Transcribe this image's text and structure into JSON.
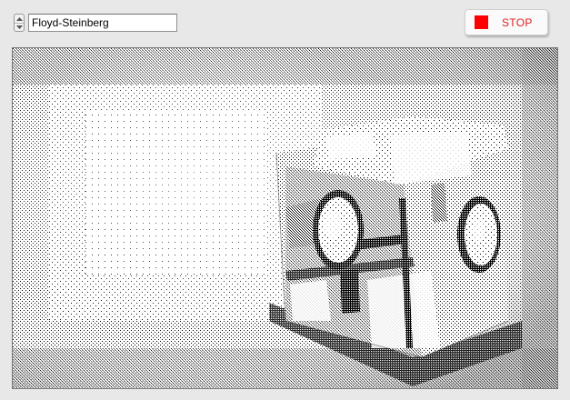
{
  "controls": {
    "dither_algorithm": "Floyd-Steinberg",
    "stop_label": "STOP"
  },
  "colors": {
    "stop_icon": "#ff0000",
    "stop_text": "#e41e1e",
    "background": "#e8e8e8"
  },
  "icons": {
    "spinner_up": "chevron-up-icon",
    "spinner_down": "chevron-down-icon",
    "stop": "stop-square-icon"
  },
  "image": {
    "subject": "dithered-companion-cube"
  }
}
